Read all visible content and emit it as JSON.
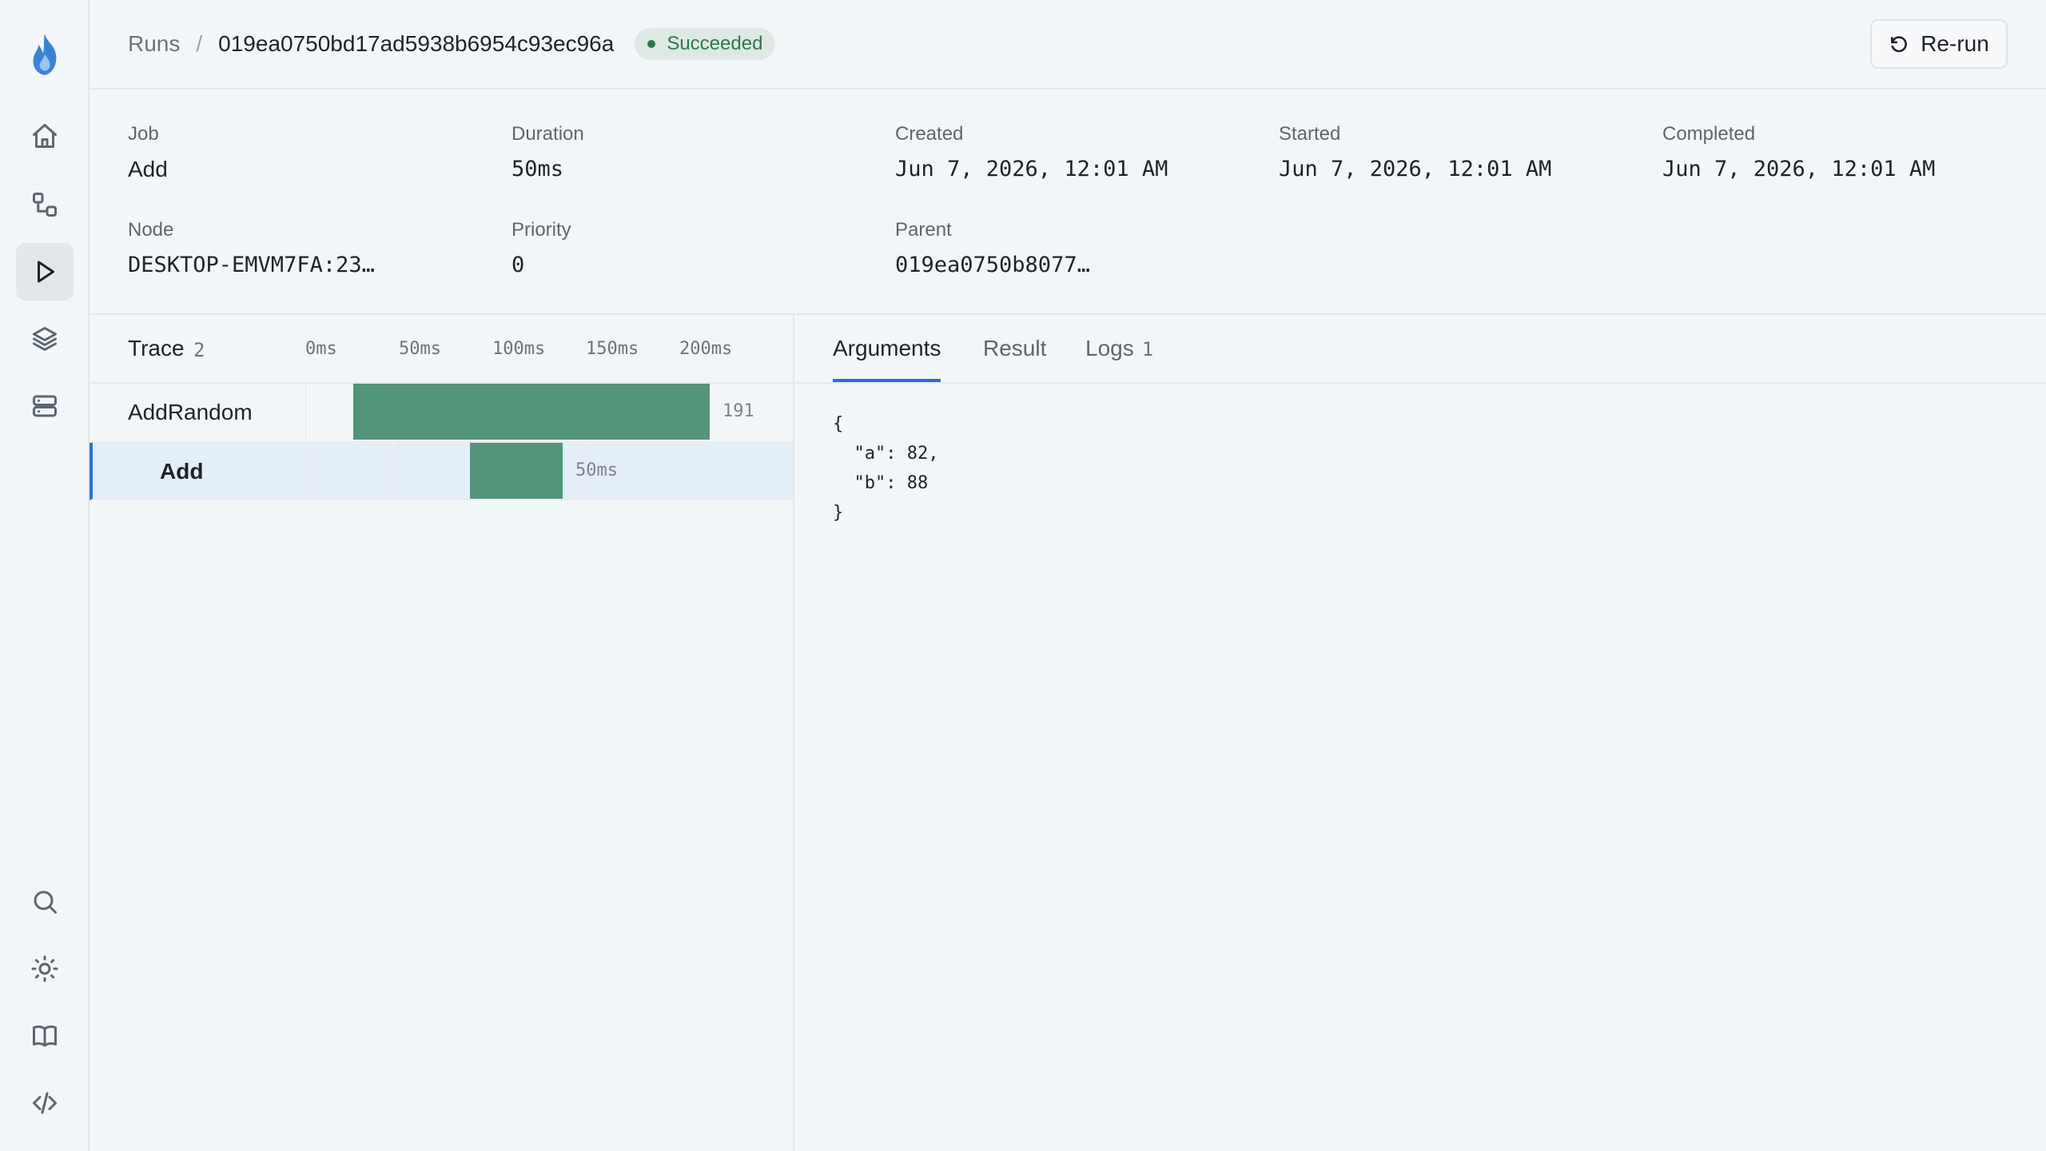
{
  "header": {
    "breadcrumb_root": "Runs",
    "breadcrumb_sep": "/",
    "run_id": "019ea0750bd17ad5938b6954c93ec96a",
    "status": "Succeeded",
    "rerun_label": "Re-run",
    "colors": {
      "status_bg": "#dde9e2",
      "status_fg": "#2d7a4f"
    }
  },
  "sidebar": {
    "top_items": [
      {
        "icon": "home-icon"
      },
      {
        "icon": "workflow-icon"
      },
      {
        "icon": "runs-play-icon",
        "active": true
      },
      {
        "icon": "layers-icon"
      },
      {
        "icon": "server-icon"
      }
    ],
    "bottom_items": [
      {
        "icon": "search-icon"
      },
      {
        "icon": "sun-icon"
      },
      {
        "icon": "book-icon"
      },
      {
        "icon": "code-icon"
      }
    ]
  },
  "meta": {
    "job": {
      "label": "Job",
      "value": "Add"
    },
    "duration": {
      "label": "Duration",
      "value": "50ms"
    },
    "created": {
      "label": "Created",
      "value": "Jun 7, 2026, 12:01 AM"
    },
    "started": {
      "label": "Started",
      "value": "Jun 7, 2026, 12:01 AM"
    },
    "completed": {
      "label": "Completed",
      "value": "Jun 7, 2026, 12:01 AM"
    },
    "node": {
      "label": "Node",
      "value": "DESKTOP-EMVM7FA:23…"
    },
    "priority": {
      "label": "Priority",
      "value": "0"
    },
    "parent": {
      "label": "Parent",
      "value": "019ea0750b8077…"
    }
  },
  "trace": {
    "title": "Trace",
    "count": "2",
    "ticks": [
      "0ms",
      "50ms",
      "100ms",
      "150ms",
      "200ms"
    ],
    "rows": [
      {
        "name": "AddRandom",
        "label": "191",
        "selected": false
      },
      {
        "name": "Add",
        "label": "50ms",
        "selected": true
      }
    ],
    "bar_color": "#52957a"
  },
  "detail": {
    "tabs": [
      {
        "label": "Arguments",
        "active": true
      },
      {
        "label": "Result",
        "active": false
      },
      {
        "label": "Logs",
        "count": "1",
        "active": false
      }
    ],
    "arguments_json": "{\n  \"a\": 82,\n  \"b\": 88\n}"
  }
}
